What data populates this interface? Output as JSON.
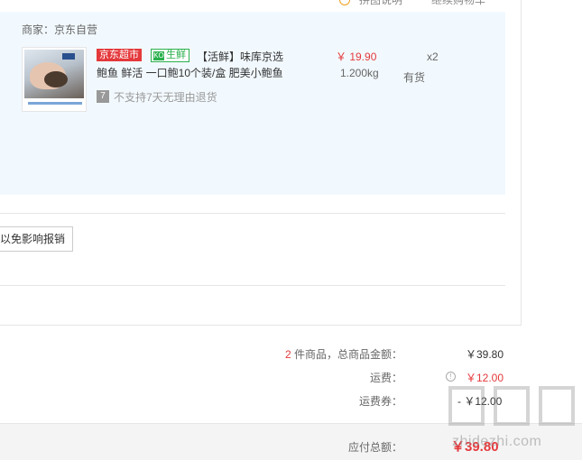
{
  "top": {
    "text_left": "拼图说明",
    "text_right": "继续购物车"
  },
  "merchant": {
    "label": "商家：京东自营"
  },
  "item": {
    "tag_jd": "京东超市",
    "tag_fresh": "生鲜",
    "fresh_icon_text": "KO",
    "name_line1": "【活鲜】味库京选",
    "name_line2": "鲍鱼 鲜活 一口鲍10个装/盒 肥美小鲍鱼",
    "price": "￥ 19.90",
    "weight": "1.200kg",
    "qty": "x2",
    "stock": "有货",
    "noreturn_icon": "7",
    "noreturn_text": "不支持7天无理由退货",
    "thumb_icon": "abalone-product-image"
  },
  "report_button": "以免影响报销",
  "summary": {
    "count": "2",
    "goods_label": " 件商品，总商品金额：",
    "goods_value": "￥39.80",
    "shipping_label": "运费：",
    "shipping_value": "￥12.00",
    "coupon_label": "运费券：",
    "coupon_value": "- ￥12.00",
    "total_label": "应付总额：",
    "total_value": "￥39.80"
  },
  "watermark": {
    "url": "zhidezhi.com"
  },
  "colors": {
    "accent_red": "#e4393c",
    "fresh_green": "#2ab04c",
    "item_bg": "#f2f9fe"
  }
}
